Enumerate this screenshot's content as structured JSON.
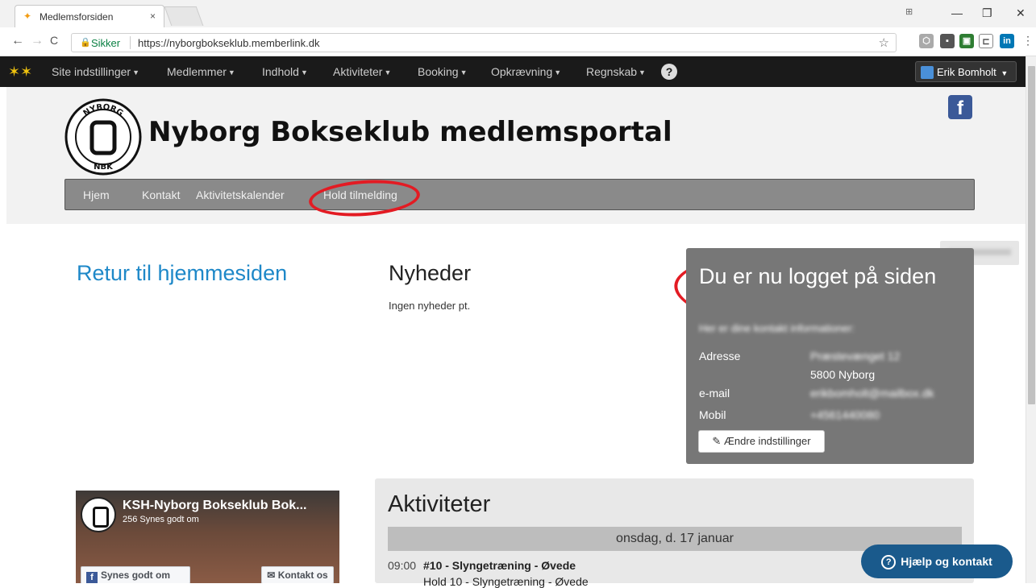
{
  "browser": {
    "tab_title": "Medlemsforsiden",
    "tab_close": "×",
    "secure_label": "Sikker",
    "url": "https://nyborgbokseklub.memberlink.dk",
    "window_controls": [
      "—",
      "❐",
      "✕"
    ],
    "nav": {
      "back": "←",
      "forward": "→",
      "reload": "C"
    },
    "star": "☆",
    "extensions": [
      "shield-icon",
      "dropbox-icon",
      "puzzle-icon",
      "cast-icon",
      "linkedin-icon"
    ],
    "extension_linkedin_label": "in"
  },
  "topnav": {
    "items": [
      {
        "label": "Site indstillinger"
      },
      {
        "label": "Medlemmer"
      },
      {
        "label": "Indhold"
      },
      {
        "label": "Aktiviteter"
      },
      {
        "label": "Booking"
      },
      {
        "label": "Opkrævning"
      },
      {
        "label": "Regnskab"
      }
    ],
    "help_glyph": "?",
    "user_name": "Erik Bomholt"
  },
  "header": {
    "club_title": "Nyborg Bokseklub medlemsportal",
    "logo_text_top": "NYBORG",
    "logo_text_bottom": "NBK",
    "facebook_glyph": "f",
    "accent_color": "#3b5998"
  },
  "subnav": {
    "items": [
      {
        "label": "Hjem"
      },
      {
        "label": "Kontakt"
      },
      {
        "label": "Aktivitetskalender"
      },
      {
        "label": "Hold tilmelding"
      }
    ]
  },
  "main": {
    "return_link": "Retur til hjemmesiden",
    "news_heading": "Nyheder",
    "news_text": "Ingen nyheder pt."
  },
  "login_box": {
    "title": "Du er nu logget på siden",
    "subtitle": "Her er dine kontakt informationer:",
    "address_label": "Adresse",
    "address_line1": "Præstevænget 12",
    "address_line2": "5800 Nyborg",
    "email_label": "e-mail",
    "email_value": "erikbomholt@mailbox.dk",
    "mobile_label": "Mobil",
    "mobile_value": "+4561440080",
    "edit_button": "Ændre indstillinger",
    "edit_icon": "✎"
  },
  "facebook_widget": {
    "page_name": "KSH-Nyborg Bokseklub Bok...",
    "likes": "256 Synes godt om",
    "like_button": "Synes godt om side",
    "contact_button": "Kontakt os",
    "contact_icon": "✉"
  },
  "activities": {
    "heading": "Aktiviteter",
    "date": "onsdag, d. 17 januar",
    "rows": [
      {
        "time": "09:00",
        "name": "#10 - Slyngetræning - Øvede"
      },
      {
        "time": "",
        "name": "Hold 10 - Slyngetræning - Øvede"
      }
    ]
  },
  "help_widget": {
    "label": "Hjælp og kontakt",
    "icon": "?"
  },
  "colors": {
    "topnav_bg": "#1a1a1a",
    "subnav_bg": "#8a8a8a",
    "link_blue": "#1e88c8",
    "annotation_red": "#e31b23",
    "help_button": "#1a5a8c"
  }
}
